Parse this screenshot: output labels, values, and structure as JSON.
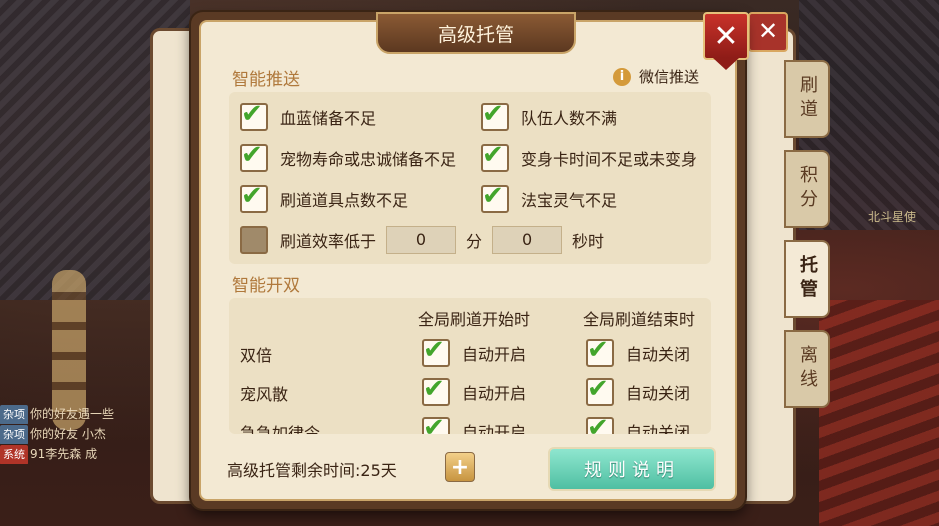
{
  "dialog": {
    "title": "高级托管",
    "close_label": "✕"
  },
  "background": {
    "close_label": "✕",
    "side_tabs": [
      "刷道",
      "积分",
      "托管",
      "离线"
    ],
    "active_tab": "托管",
    "npc_name": "北斗星使",
    "chat": [
      {
        "tag": "杂项",
        "text": "你的好友遇一些",
        "tag_color": "blue"
      },
      {
        "tag": "杂项",
        "text": "你的好友 小杰",
        "tag_color": "blue"
      },
      {
        "tag": "系统",
        "text": "91李先森 成",
        "tag_color": "red"
      }
    ]
  },
  "push": {
    "title": "智能推送",
    "wechat_label": "微信推送",
    "items": [
      {
        "label": "血蓝储备不足",
        "checked": true
      },
      {
        "label": "队伍人数不满",
        "checked": true
      },
      {
        "label": "宠物寿命或忠诚储备不足",
        "checked": true
      },
      {
        "label": "变身卡时间不足或未变身",
        "checked": true
      },
      {
        "label": "刷道道具点数不足",
        "checked": true
      },
      {
        "label": "法宝灵气不足",
        "checked": true
      }
    ],
    "efficiency": {
      "label": "刷道效率低于",
      "checked": false,
      "value1": "0",
      "unit1": "分",
      "value2": "0",
      "unit2": "秒时"
    }
  },
  "double": {
    "title": "智能开双",
    "col_start": "全局刷道开始时",
    "col_end": "全局刷道结束时",
    "rows": [
      {
        "label": "双倍",
        "start": "自动开启",
        "end": "自动关闭"
      },
      {
        "label": "宠风散",
        "start": "自动开启",
        "end": "自动关闭"
      },
      {
        "label": "急急如律令",
        "start": "自动开启",
        "end": "自动关闭"
      }
    ]
  },
  "footer": {
    "remaining": "高级托管剩余时间:25天",
    "plus_label": "+",
    "rules_label": "规则说明"
  }
}
